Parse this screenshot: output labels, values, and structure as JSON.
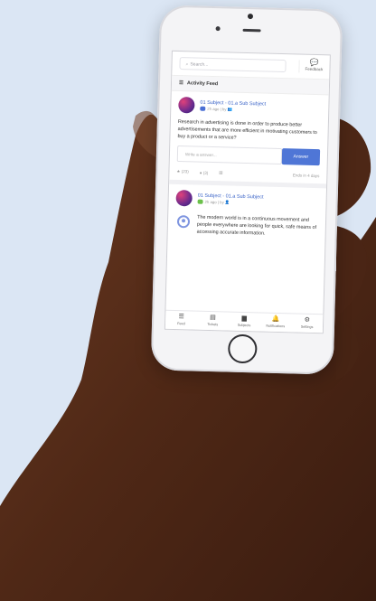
{
  "app": {
    "search": {
      "placeholder": "Search..."
    },
    "feedback_label": "Feedback",
    "feed_title": "Activity Feed",
    "cards": [
      {
        "subject": "01 Subject - 01.a Sub Subject",
        "meta": "2h ago | by",
        "question": "Research in advertising is done in order to produce better advertisements that are more efficient in motivating customers to buy a product or a service?",
        "answer_placeholder": "Write a answer...",
        "answer_button": "Answer",
        "stats": {
          "likes": "(23)",
          "comments": "(3)",
          "ends": "Ends in 4 days"
        }
      },
      {
        "subject": "01 Subject - 01.a Sub Subject",
        "meta": "2h ago | by",
        "answer": "The modern world is in a continuous movement and people everywhere are looking for quick, safe means of accessing accurate information."
      }
    ],
    "tabs": [
      "Feed",
      "Tickets",
      "Subjects",
      "Notifications",
      "Settings"
    ]
  }
}
